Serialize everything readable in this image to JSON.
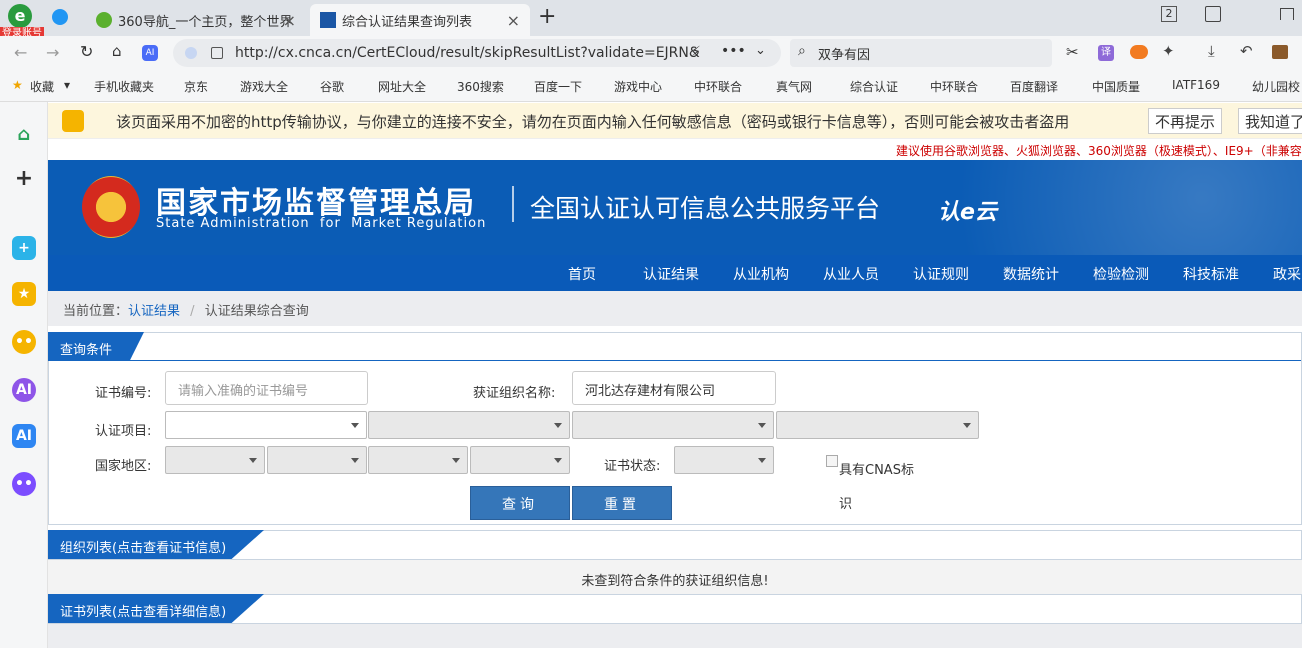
{
  "browser": {
    "login_badge": "登录账号",
    "tabs": [
      {
        "label": "360导航_一个主页，整个世界"
      },
      {
        "label": "综合认证结果查询列表"
      }
    ],
    "new_tab": "+",
    "tab_count": "2",
    "url": "http://cx.cnca.cn/CertECloud/result/skipResultList?validate=EJRN&",
    "search_text": "双争有因",
    "bookmarks": [
      "收藏",
      "手机收藏夹",
      "京东",
      "游戏大全",
      "谷歌",
      "网址大全",
      "360搜索",
      "百度一下",
      "游戏中心",
      "中环联合",
      "真气网",
      "综合认证",
      "中环联合",
      "百度翻译",
      "中国质量",
      "IATF169",
      "幼儿园校"
    ]
  },
  "warning": {
    "text": "该页面采用不加密的http传输协议，与你建立的连接不安全，请勿在页面内输入任何敏感信息（密码或银行卡信息等），否则可能会被攻击者盗用",
    "dismiss": "不再提示",
    "ok": "我知道了"
  },
  "compat_notice": "建议使用谷歌浏览器、火狐浏览器、360浏览器（极速模式）、IE9+（非兼容",
  "header": {
    "org_cn": "国家市场监督管理总局",
    "org_en": "State Administration  for  Market Regulation",
    "platform": "全国认证认可信息公共服务平台",
    "logo_text": "认e云"
  },
  "nav": [
    "首页",
    "认证结果",
    "从业机构",
    "从业人员",
    "认证规则",
    "数据统计",
    "检验检测",
    "科技标准",
    "政采"
  ],
  "breadcrumb": {
    "prefix": "当前位置：",
    "link": "认证结果",
    "sep": "/",
    "current": "认证结果综合查询"
  },
  "query": {
    "title": "查询条件",
    "cert_no_label": "证书编号:",
    "cert_no_placeholder": "请输入准确的证书编号",
    "org_label": "获证组织名称:",
    "org_value": "河北达存建材有限公司",
    "project_label": "认证项目:",
    "region_label": "国家地区:",
    "status_label": "证书状态:",
    "cnas_label": "具有CNAS标识",
    "search_btn": "查询",
    "reset_btn": "重置"
  },
  "org_list": {
    "title": "组织列表(点击查看证书信息)",
    "empty": "未查到符合条件的获证组织信息!"
  },
  "cert_list": {
    "title": "证书列表(点击查看详细信息)"
  }
}
